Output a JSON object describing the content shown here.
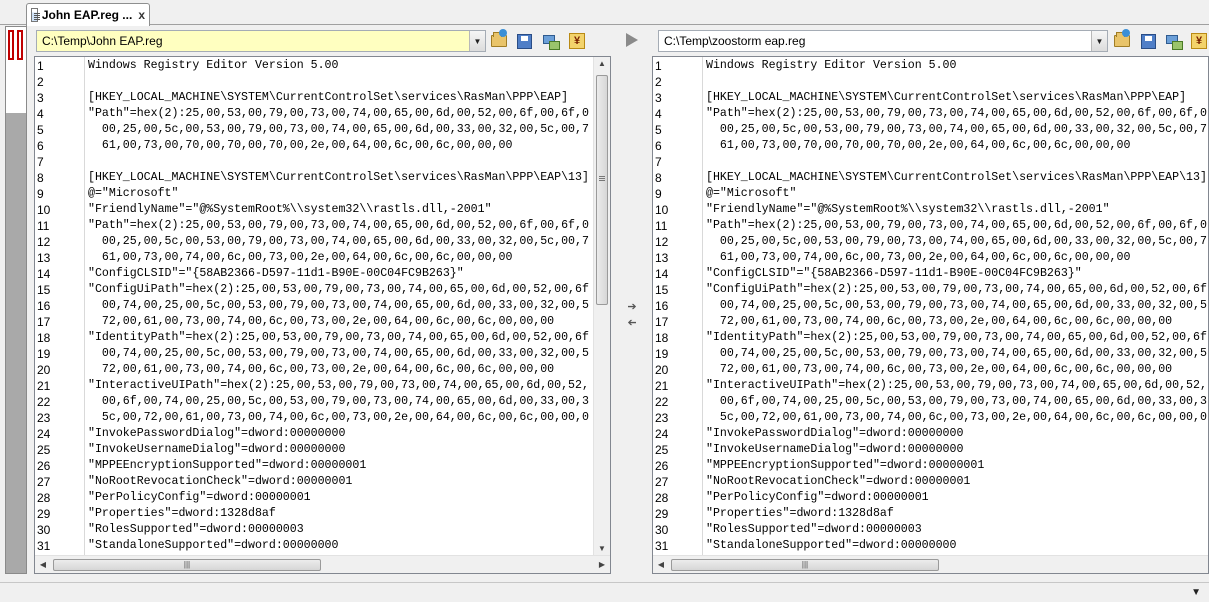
{
  "tab": {
    "label": "John EAP.reg ...",
    "close": "x"
  },
  "left": {
    "path": "C:\\Temp\\John EAP.reg",
    "lines": [
      "Windows Registry Editor Version 5.00",
      "",
      "[HKEY_LOCAL_MACHINE\\SYSTEM\\CurrentControlSet\\services\\RasMan\\PPP\\EAP]",
      "\"Path\"=hex(2):25,00,53,00,79,00,73,00,74,00,65,00,6d,00,52,00,6f,00,6f,0",
      "  00,25,00,5c,00,53,00,79,00,73,00,74,00,65,00,6d,00,33,00,32,00,5c,00,7",
      "  61,00,73,00,70,00,70,00,70,00,2e,00,64,00,6c,00,6c,00,00,00",
      "",
      "[HKEY_LOCAL_MACHINE\\SYSTEM\\CurrentControlSet\\services\\RasMan\\PPP\\EAP\\13]",
      "@=\"Microsoft\"",
      "\"FriendlyName\"=\"@%SystemRoot%\\\\system32\\\\rastls.dll,-2001\"",
      "\"Path\"=hex(2):25,00,53,00,79,00,73,00,74,00,65,00,6d,00,52,00,6f,00,6f,0",
      "  00,25,00,5c,00,53,00,79,00,73,00,74,00,65,00,6d,00,33,00,32,00,5c,00,7",
      "  61,00,73,00,74,00,6c,00,73,00,2e,00,64,00,6c,00,6c,00,00,00",
      "\"ConfigCLSID\"=\"{58AB2366-D597-11d1-B90E-00C04FC9B263}\"",
      "\"ConfigUiPath\"=hex(2):25,00,53,00,79,00,73,00,74,00,65,00,6d,00,52,00,6f",
      "  00,74,00,25,00,5c,00,53,00,79,00,73,00,74,00,65,00,6d,00,33,00,32,00,5",
      "  72,00,61,00,73,00,74,00,6c,00,73,00,2e,00,64,00,6c,00,6c,00,00,00",
      "\"IdentityPath\"=hex(2):25,00,53,00,79,00,73,00,74,00,65,00,6d,00,52,00,6f",
      "  00,74,00,25,00,5c,00,53,00,79,00,73,00,74,00,65,00,6d,00,33,00,32,00,5",
      "  72,00,61,00,73,00,74,00,6c,00,73,00,2e,00,64,00,6c,00,6c,00,00,00",
      "\"InteractiveUIPath\"=hex(2):25,00,53,00,79,00,73,00,74,00,65,00,6d,00,52,",
      "  00,6f,00,74,00,25,00,5c,00,53,00,79,00,73,00,74,00,65,00,6d,00,33,00,3",
      "  5c,00,72,00,61,00,73,00,74,00,6c,00,73,00,2e,00,64,00,6c,00,6c,00,00,0",
      "\"InvokePasswordDialog\"=dword:00000000",
      "\"InvokeUsernameDialog\"=dword:00000000",
      "\"MPPEEncryptionSupported\"=dword:00000001",
      "\"NoRootRevocationCheck\"=dword:00000001",
      "\"PerPolicyConfig\"=dword:00000001",
      "\"Properties\"=dword:1328d8af",
      "\"RolesSupported\"=dword:00000003",
      "\"StandaloneSupported\"=dword:00000000"
    ]
  },
  "right": {
    "path": "C:\\Temp\\zoostorm eap.reg",
    "lines": [
      "Windows Registry Editor Version 5.00",
      "",
      "[HKEY_LOCAL_MACHINE\\SYSTEM\\CurrentControlSet\\services\\RasMan\\PPP\\EAP]",
      "\"Path\"=hex(2):25,00,53,00,79,00,73,00,74,00,65,00,6d,00,52,00,6f,00,6f,0",
      "  00,25,00,5c,00,53,00,79,00,73,00,74,00,65,00,6d,00,33,00,32,00,5c,00,7",
      "  61,00,73,00,70,00,70,00,70,00,2e,00,64,00,6c,00,6c,00,00,00",
      "",
      "[HKEY_LOCAL_MACHINE\\SYSTEM\\CurrentControlSet\\services\\RasMan\\PPP\\EAP\\13]",
      "@=\"Microsoft\"",
      "\"FriendlyName\"=\"@%SystemRoot%\\\\system32\\\\rastls.dll,-2001\"",
      "\"Path\"=hex(2):25,00,53,00,79,00,73,00,74,00,65,00,6d,00,52,00,6f,00,6f,0",
      "  00,25,00,5c,00,53,00,79,00,73,00,74,00,65,00,6d,00,33,00,32,00,5c,00,7",
      "  61,00,73,00,74,00,6c,00,73,00,2e,00,64,00,6c,00,6c,00,00,00",
      "\"ConfigCLSID\"=\"{58AB2366-D597-11d1-B90E-00C04FC9B263}\"",
      "\"ConfigUiPath\"=hex(2):25,00,53,00,79,00,73,00,74,00,65,00,6d,00,52,00,6f",
      "  00,74,00,25,00,5c,00,53,00,79,00,73,00,74,00,65,00,6d,00,33,00,32,00,5",
      "  72,00,61,00,73,00,74,00,6c,00,73,00,2e,00,64,00,6c,00,6c,00,00,00",
      "\"IdentityPath\"=hex(2):25,00,53,00,79,00,73,00,74,00,65,00,6d,00,52,00,6f",
      "  00,74,00,25,00,5c,00,53,00,79,00,73,00,74,00,65,00,6d,00,33,00,32,00,5",
      "  72,00,61,00,73,00,74,00,6c,00,73,00,2e,00,64,00,6c,00,6c,00,00,00",
      "\"InteractiveUIPath\"=hex(2):25,00,53,00,79,00,73,00,74,00,65,00,6d,00,52,",
      "  00,6f,00,74,00,25,00,5c,00,53,00,79,00,73,00,74,00,65,00,6d,00,33,00,3",
      "  5c,00,72,00,61,00,73,00,74,00,6c,00,73,00,2e,00,64,00,6c,00,6c,00,00,0",
      "\"InvokePasswordDialog\"=dword:00000000",
      "\"InvokeUsernameDialog\"=dword:00000000",
      "\"MPPEEncryptionSupported\"=dword:00000001",
      "\"NoRootRevocationCheck\"=dword:00000001",
      "\"PerPolicyConfig\"=dword:00000001",
      "\"Properties\"=dword:1328d8af",
      "\"RolesSupported\"=dword:00000003",
      "\"StandaloneSupported\"=dword:00000000"
    ]
  },
  "icons": {
    "browse": "folder-icon",
    "save": "save-icon",
    "network": "network-icon",
    "filter": "filter-icon",
    "filter_glyph": "¥"
  },
  "colors": {
    "left_path_bg": "#ffffc0",
    "right_path_bg": "#ffffff",
    "thumb_marker": "#c00000"
  }
}
